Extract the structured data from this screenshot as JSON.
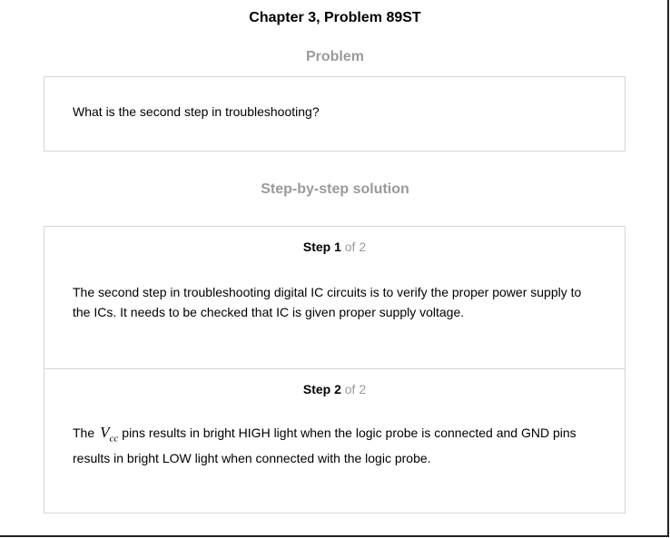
{
  "header": {
    "title": "Chapter 3, Problem 89ST"
  },
  "problem": {
    "heading": "Problem",
    "text": "What is the second step in troubleshooting?"
  },
  "solution": {
    "heading": "Step-by-step solution",
    "steps": [
      {
        "label": "Step 1",
        "of": "of 2",
        "text": "The second step in troubleshooting digital IC circuits is to verify the proper power supply to the ICs. It needs to be checked that IC is given proper supply voltage."
      },
      {
        "label": "Step 2",
        "of": "of 2",
        "text_before": "The",
        "symbol_main": "V",
        "symbol_sub": "cc",
        "text_after": "pins results in bright HIGH light when the logic probe is connected and GND pins results in bright LOW light when connected with the logic probe."
      }
    ]
  }
}
